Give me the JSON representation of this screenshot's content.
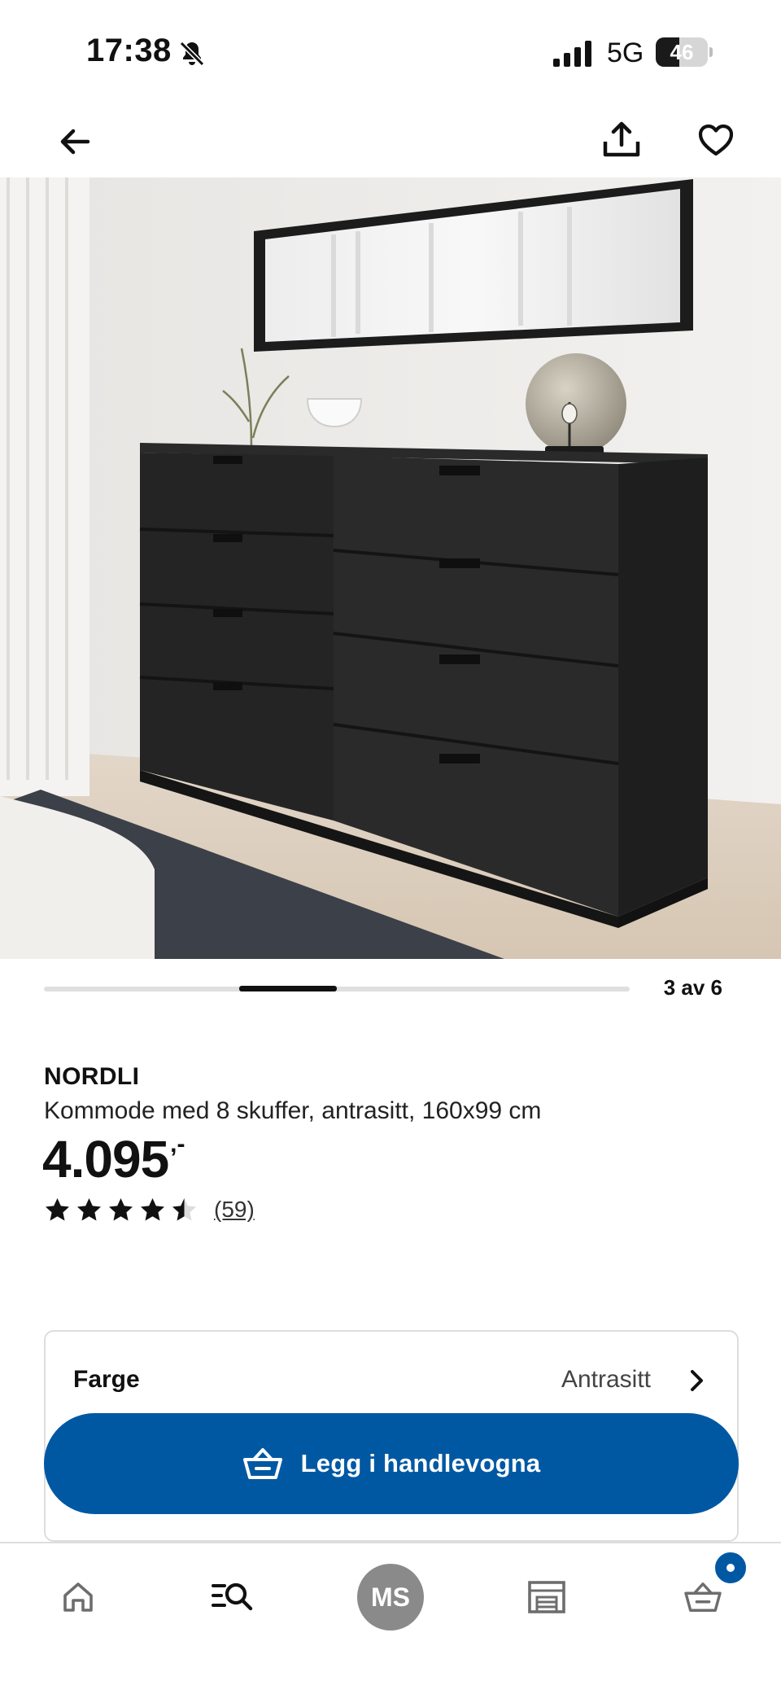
{
  "status_bar": {
    "time": "17:38",
    "network": "5G",
    "battery_level": "46",
    "battery_fraction": 0.46
  },
  "toolbar": {
    "back_icon": "arrow-left-icon",
    "share_icon": "share-icon",
    "favorite_icon": "heart-icon"
  },
  "gallery": {
    "counter": "3 av 6",
    "current": 3,
    "total": 6
  },
  "product": {
    "brand": "NORDLI",
    "description": "Kommode med 8 skuffer, antrasitt, 160x99 cm",
    "price": "4.095",
    "price_suffix": ",-",
    "rating_value": 4.5,
    "rating_max": 5,
    "review_count": "(59)"
  },
  "options": {
    "color_label": "Farge",
    "color_value": "Antrasitt"
  },
  "cart_button": {
    "label": "Legg i handlevogna",
    "icon": "basket-icon"
  },
  "bottom_nav": {
    "items": [
      {
        "name": "home",
        "icon": "home-icon"
      },
      {
        "name": "search",
        "icon": "search-list-icon"
      },
      {
        "name": "profile",
        "initials": "MS"
      },
      {
        "name": "store",
        "icon": "store-icon"
      },
      {
        "name": "cart",
        "icon": "basket-icon"
      }
    ]
  },
  "colors": {
    "primary": "#0058a3",
    "text": "#111111",
    "avatar": "#8a8a8a",
    "dresser": "#1e1e1e"
  }
}
